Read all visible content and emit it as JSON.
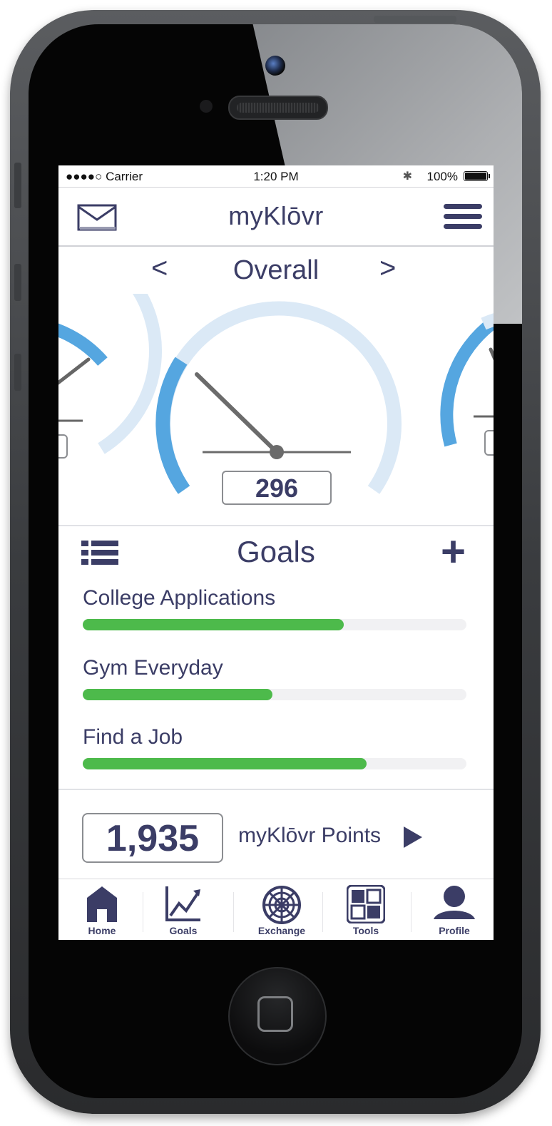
{
  "status_bar": {
    "carrier": "●●●●○ Carrier",
    "time": "1:20 PM",
    "battery": "100%"
  },
  "nav": {
    "brand": "myKlōvr",
    "mail_icon": "envelope-icon",
    "menu_icon": "hamburger-icon"
  },
  "gauge": {
    "prev_arrow": "<",
    "title": "Overall",
    "next_arrow": ">",
    "score": "296"
  },
  "goals": {
    "title": "Goals",
    "list_icon": "list-icon",
    "add_icon": "+",
    "items": [
      {
        "label": "College Applications",
        "progress": 0.68
      },
      {
        "label": "Gym Everyday",
        "progress": 0.495
      },
      {
        "label": "Find a Job",
        "progress": 0.74
      }
    ]
  },
  "points": {
    "value": "1,935",
    "label": "myKlōvr Points"
  },
  "tabbar": {
    "items": [
      {
        "label": "Home",
        "icon": "house-icon"
      },
      {
        "label": "Goals",
        "icon": "chart-icon"
      },
      {
        "label": "Exchange",
        "icon": "web-icon"
      },
      {
        "label": "Tools",
        "icon": "tools-grid-icon"
      },
      {
        "label": "Profile",
        "icon": "person-icon"
      }
    ]
  },
  "colors": {
    "navy": "#3b3d66",
    "gauge_blue": "#55a6e0",
    "gauge_light": "#dbe9f6",
    "progress_green": "#4dba4b",
    "track": "#f1f1f3"
  }
}
